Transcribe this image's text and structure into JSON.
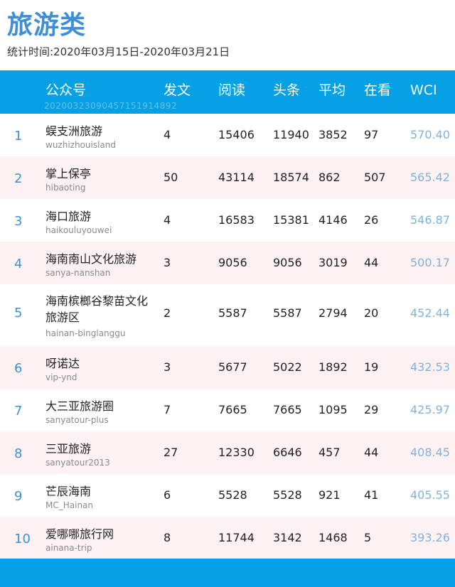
{
  "title": "旅游类",
  "period": "统计时间:2020年03月15日-2020年03月21日",
  "columns": {
    "account": "公众号",
    "posts": "发文",
    "reads": "阅读",
    "headline": "头条",
    "average": "平均",
    "likes": "在看",
    "wci": "WCI"
  },
  "watermark": "20200323090457151914892",
  "rows": [
    {
      "rank": "1",
      "name": "蜈支洲旅游",
      "account": "wuzhizhouisland",
      "posts": "4",
      "reads": "15406",
      "headline": "11940",
      "average": "3852",
      "likes": "97",
      "wci": "570.40"
    },
    {
      "rank": "2",
      "name": "掌上保亭",
      "account": "hibaoting",
      "posts": "50",
      "reads": "43114",
      "headline": "18574",
      "average": "862",
      "likes": "507",
      "wci": "565.42"
    },
    {
      "rank": "3",
      "name": "海口旅游",
      "account": "haikouluyouwei",
      "posts": "4",
      "reads": "16583",
      "headline": "15381",
      "average": "4146",
      "likes": "26",
      "wci": "546.87"
    },
    {
      "rank": "4",
      "name": "海南南山文化旅游",
      "account": "sanya-nanshan",
      "posts": "3",
      "reads": "9056",
      "headline": "9056",
      "average": "3019",
      "likes": "44",
      "wci": "500.17"
    },
    {
      "rank": "5",
      "name": "海南槟榔谷黎苗文化旅游区",
      "account": "hainan-binglanggu",
      "posts": "2",
      "reads": "5587",
      "headline": "5587",
      "average": "2794",
      "likes": "20",
      "wci": "452.44"
    },
    {
      "rank": "6",
      "name": "呀诺达",
      "account": "vip-ynd",
      "posts": "3",
      "reads": "5677",
      "headline": "5022",
      "average": "1892",
      "likes": "19",
      "wci": "432.53"
    },
    {
      "rank": "7",
      "name": "大三亚旅游圈",
      "account": "sanyatour-plus",
      "posts": "7",
      "reads": "7665",
      "headline": "7665",
      "average": "1095",
      "likes": "29",
      "wci": "425.97"
    },
    {
      "rank": "8",
      "name": "三亚旅游",
      "account": "sanyatour2013",
      "posts": "27",
      "reads": "12330",
      "headline": "6646",
      "average": "457",
      "likes": "44",
      "wci": "408.45"
    },
    {
      "rank": "9",
      "name": "芒辰海南",
      "account": "MC_Hainan",
      "posts": "6",
      "reads": "5528",
      "headline": "5528",
      "average": "921",
      "likes": "41",
      "wci": "405.55"
    },
    {
      "rank": "10",
      "name": "爱哪哪旅行网",
      "account": "ainana-trip",
      "posts": "8",
      "reads": "11744",
      "headline": "3142",
      "average": "1468",
      "likes": "5",
      "wci": "393.26"
    }
  ]
}
